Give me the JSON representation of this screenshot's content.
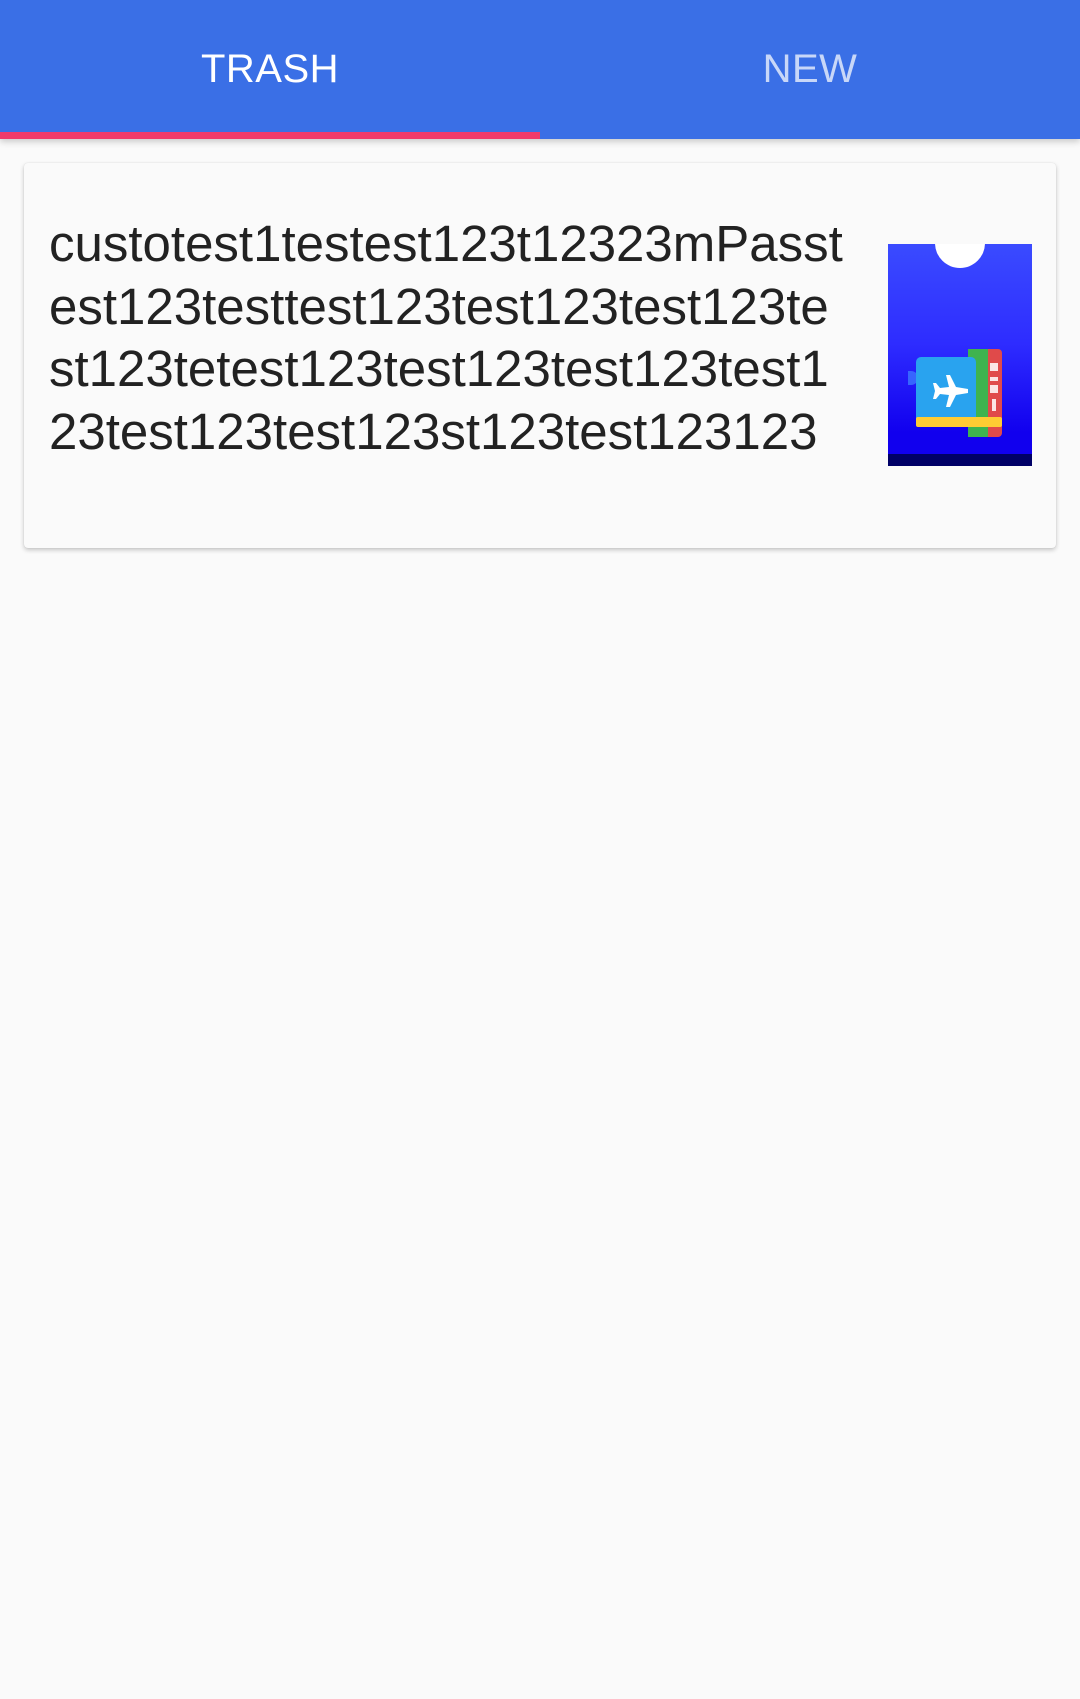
{
  "tabs": [
    {
      "label": "TRASH",
      "selected": true
    },
    {
      "label": "NEW",
      "selected": false
    }
  ],
  "colors": {
    "tabbar_bg": "#3a6fe6",
    "indicator": "#f03a6b",
    "page_bg": "#fafafa",
    "text_primary": "#222222"
  },
  "cards": [
    {
      "title": "custotest1testest123t12323mPasstest123testtest123test123test123test123tetest123test123test123test123test123test123st123test123123",
      "thumbnail_icon": "boarding-pass-icon"
    }
  ]
}
